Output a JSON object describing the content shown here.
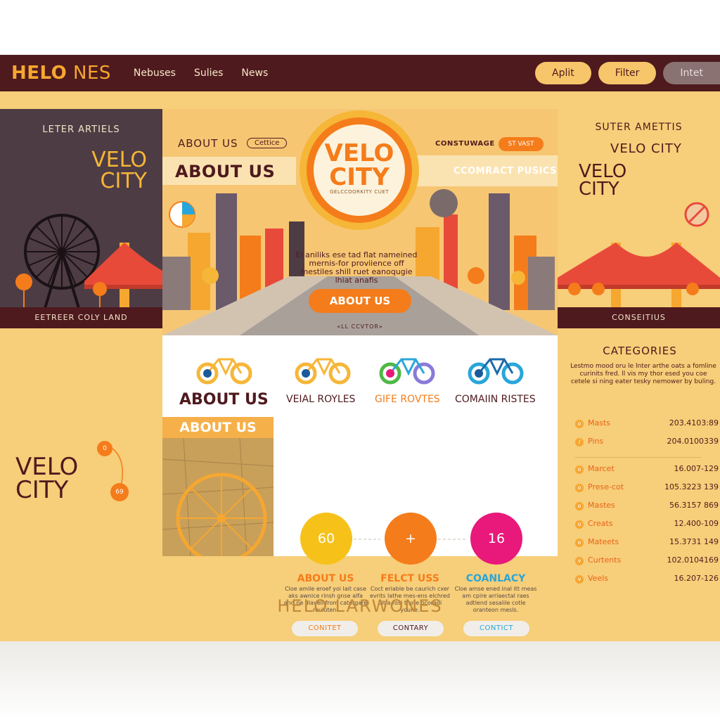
{
  "colors": {
    "dark": "#4e1a1e",
    "accent": "#f6a730",
    "orange": "#f57c1a",
    "page": "#f7ce79",
    "pink": "#e8197a",
    "teal": "#29a6d9"
  },
  "header": {
    "logo_a": "HELO",
    "logo_b": " NES",
    "nav": [
      "Nebuses",
      "Sulies",
      "News"
    ],
    "buttons": [
      "Aplit",
      "Filter",
      "Intet"
    ]
  },
  "left_panel": {
    "kicker": "LETER ARTIELS",
    "title_1": "VELO",
    "title_2": "CITY",
    "bar": "EETREER COLY LAND"
  },
  "right_panel": {
    "kicker": "SUTER AMETTIS",
    "subtitle": "VELO CITY",
    "title_1": "VELO",
    "title_2": "CITY",
    "bar": "CONSEITIUS"
  },
  "hero": {
    "about_small": "ABOUT US",
    "chip": "Cettice",
    "about_big": "ABOUT US",
    "cons": "CONSTUWAGE",
    "orange_chip": "ST VAST",
    "compact": "CCOMRACT PUSICS",
    "badge_1": "VELO",
    "badge_2": "CITY",
    "badge_sub": "GELCCOORKITY CUET",
    "sky_text": "El aniliks ese tad flat nameined mernis-for proviience off mestiles shill ruet eanoqugie lhiat anafis",
    "button": "ABOUT US",
    "caption": "«LL CCVTOR»"
  },
  "features": {
    "labels": [
      "ABOUT US",
      "VEIAL ROYLES",
      "GIFE ROVTES",
      "COMAIIN RISTES"
    ],
    "band": "ABOUT US",
    "cards": [
      {
        "num": "60",
        "title": "ABOUT US",
        "body": "Cloe amile eroef yoi lait case aks awnice rinsh gnse alfa and ne dlavell from catergare reuluten.",
        "btn": "CONITET"
      },
      {
        "num": "+",
        "title": "FELCT USS",
        "body": "Coct eriable be caurich cxer evrits lathe mes-ens elchred oit a rosi thote ocoradi youne.",
        "btn": "CONTARY"
      },
      {
        "num": "16",
        "title": "COANLACY",
        "body": "Cloe amse ened inal itt meas am cpire arriaectal raes adtlend sesalile cotle oranteon mesls.",
        "btn": "CONTICT"
      }
    ]
  },
  "categories": {
    "title": "CATEGORIES",
    "desc": "Lestmo mood oru le lnter arthe oats a fomline curinits fred. ll vis my thor esed you coe cetele si ning eater tesky nemower by buling.",
    "items": [
      {
        "icon": "o",
        "label": "Masts",
        "value": "203.4103:89"
      },
      {
        "icon": "/",
        "label": "Pins",
        "value": "204.0100339"
      },
      {
        "icon": "o",
        "label": "Marcet",
        "value": "16.007-129"
      },
      {
        "icon": "o",
        "label": "Prese-cot",
        "value": "105.3223 139"
      },
      {
        "icon": "o",
        "label": "Mastes",
        "value": "56.3157 869"
      },
      {
        "icon": "o",
        "label": "Creats",
        "value": "12.400-109"
      },
      {
        "icon": "o",
        "label": "Mateets",
        "value": "15.3731 149"
      },
      {
        "icon": "v",
        "label": "Curtents",
        "value": "102.0104169"
      },
      {
        "icon": "v",
        "label": "Veels",
        "value": "16.207-126"
      }
    ]
  },
  "left_lower": {
    "title_1": "VELO",
    "title_2": "CITY",
    "node_a": "0",
    "node_b": "69"
  },
  "footer": "HELO LARWONES"
}
